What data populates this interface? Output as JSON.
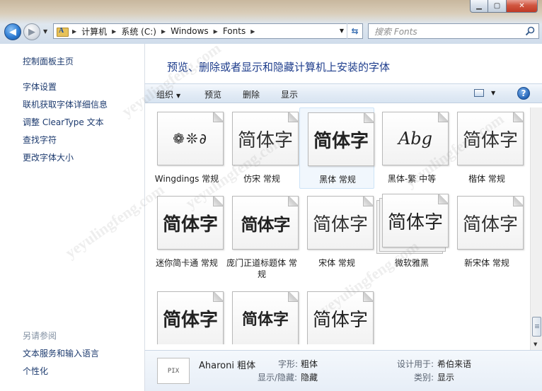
{
  "window": {
    "min_glyph": "▁",
    "max_glyph": "▢",
    "close_glyph": "✕"
  },
  "nav": {
    "back_glyph": "◀",
    "forward_glyph": "▶",
    "dropdown_glyph": "▼"
  },
  "address": {
    "crumbs": [
      "计算机",
      "系统 (C:)",
      "Windows",
      "Fonts"
    ],
    "sep": "▶",
    "dropdown_glyph": "▼",
    "refresh_glyph": "⇆"
  },
  "search": {
    "placeholder": "搜索 Fonts"
  },
  "leftnav": {
    "home": "控制面板主页",
    "links": [
      "字体设置",
      "联机获取字体详细信息",
      "调整 ClearType 文本",
      "查找字符",
      "更改字体大小"
    ],
    "see_also": "另请参阅",
    "see_also_links": [
      "文本服务和输入语言",
      "个性化"
    ]
  },
  "heading": "预览、删除或者显示和隐藏计算机上安装的字体",
  "toolbar": {
    "organize": "组织",
    "organize_dd": "▼",
    "preview": "预览",
    "delete": "删除",
    "show": "显示",
    "view_dd": "▼",
    "help": "?"
  },
  "fonts": [
    {
      "sample": "❁❊∂",
      "name": "Wingdings 常规"
    },
    {
      "sample": "简体字",
      "name": "仿宋 常规"
    },
    {
      "sample": "简体字",
      "name": "黑体 常规"
    },
    {
      "sample": "Abg",
      "name": "黑体-繁 中等"
    },
    {
      "sample": "简体字",
      "name": "楷体 常规"
    },
    {
      "sample": "简体字",
      "name": "迷你简卡通 常规"
    },
    {
      "sample": "简体字",
      "name": "庞门正道标题体 常规"
    },
    {
      "sample": "简体字",
      "name": "宋体 常规"
    },
    {
      "sample": "简体字",
      "name": "微软雅黑"
    },
    {
      "sample": "简体字",
      "name": "新宋体 常规"
    },
    {
      "sample": "简体字",
      "name": ""
    },
    {
      "sample": "简体字",
      "name": ""
    },
    {
      "sample": "简体字",
      "name": ""
    }
  ],
  "details": {
    "thumb": "PIX",
    "name": "Aharoni 粗体",
    "style_label": "字形:",
    "style_value": "粗体",
    "visibility_label": "显示/隐藏:",
    "visibility_value": "隐藏",
    "designed_label": "设计用于:",
    "designed_value": "希伯来语",
    "category_label": "类别:",
    "category_value": "显示"
  },
  "watermark": "yeyulingfeng.com",
  "colors": {
    "link": "#1c3a6e",
    "heading": "#1e3d8c",
    "close": "#c03a25",
    "accent": "#2f7dd4"
  }
}
